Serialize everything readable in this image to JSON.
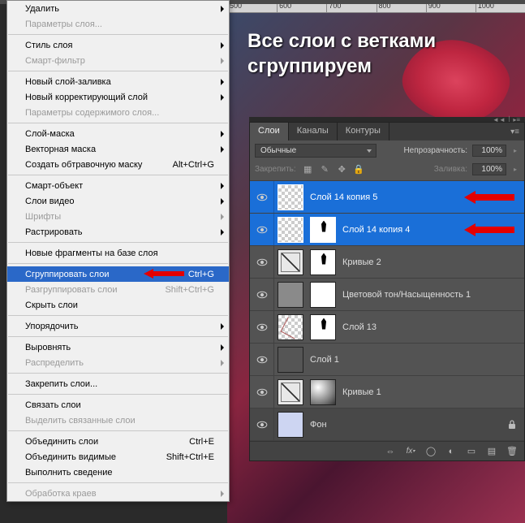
{
  "ruler": [
    "500",
    "600",
    "700",
    "800",
    "900",
    "1000"
  ],
  "canvas_title_line1": "Все слои с ветками",
  "canvas_title_line2": "сгруппируем",
  "menu": {
    "items": [
      {
        "label": "Удалить",
        "arrow": true,
        "disabled": false
      },
      {
        "label": "Параметры слоя...",
        "disabled": true
      },
      {
        "sep": true
      },
      {
        "label": "Стиль слоя",
        "arrow": true
      },
      {
        "label": "Смарт-фильтр",
        "arrow": true,
        "disabled": true
      },
      {
        "sep": true
      },
      {
        "label": "Новый слой-заливка",
        "arrow": true
      },
      {
        "label": "Новый корректирующий слой",
        "arrow": true
      },
      {
        "label": "Параметры содержимого слоя...",
        "disabled": true
      },
      {
        "sep": true
      },
      {
        "label": "Слой-маска",
        "arrow": true
      },
      {
        "label": "Векторная маска",
        "arrow": true
      },
      {
        "label": "Создать обтравочную маску",
        "shortcut": "Alt+Ctrl+G"
      },
      {
        "sep": true
      },
      {
        "label": "Смарт-объект",
        "arrow": true
      },
      {
        "label": "Слои видео",
        "arrow": true
      },
      {
        "label": "Шрифты",
        "arrow": true,
        "disabled": true
      },
      {
        "label": "Растрировать",
        "arrow": true
      },
      {
        "sep": true
      },
      {
        "label": "Новые фрагменты на базе слоя"
      },
      {
        "sep": true
      },
      {
        "label": "Сгруппировать слои",
        "shortcut": "Ctrl+G",
        "highlighted": true,
        "arrow_ind": true
      },
      {
        "label": "Разгруппировать слои",
        "shortcut": "Shift+Ctrl+G",
        "disabled": true
      },
      {
        "label": "Скрыть слои"
      },
      {
        "sep": true
      },
      {
        "label": "Упорядочить",
        "arrow": true
      },
      {
        "sep": true
      },
      {
        "label": "Выровнять",
        "arrow": true
      },
      {
        "label": "Распределить",
        "arrow": true,
        "disabled": true
      },
      {
        "sep": true
      },
      {
        "label": "Закрепить слои..."
      },
      {
        "sep": true
      },
      {
        "label": "Связать слои"
      },
      {
        "label": "Выделить связанные слои",
        "disabled": true
      },
      {
        "sep": true
      },
      {
        "label": "Объединить слои",
        "shortcut": "Ctrl+E"
      },
      {
        "label": "Объединить видимые",
        "shortcut": "Shift+Ctrl+E"
      },
      {
        "label": "Выполнить сведение"
      },
      {
        "sep": true
      },
      {
        "label": "Обработка краев",
        "arrow": true,
        "disabled": true
      }
    ]
  },
  "panel": {
    "tabs": {
      "layers": "Слои",
      "channels": "Каналы",
      "paths": "Контуры"
    },
    "blend_mode": "Обычные",
    "opacity_label": "Непрозрачность:",
    "opacity_value": "100%",
    "lock_label": "Закрепить:",
    "fill_label": "Заливка:",
    "fill_value": "100%",
    "layers": [
      {
        "name": "Слой 14 копия 5",
        "selected": true,
        "thumbs": [
          "checker"
        ],
        "arrow": true
      },
      {
        "name": "Слой 14 копия 4",
        "selected": true,
        "thumbs": [
          "checker",
          "mask-blot"
        ],
        "arrow": true
      },
      {
        "name": "Кривые 2",
        "thumbs": [
          "curves",
          "mask-blot"
        ]
      },
      {
        "name": "Цветовой тон/Насыщенность 1",
        "thumbs": [
          "gray",
          "mask"
        ]
      },
      {
        "name": "Слой 13",
        "thumbs": [
          "scribble",
          "mask-blot"
        ]
      },
      {
        "name": "Слой 1",
        "thumbs": [
          "dark"
        ]
      },
      {
        "name": "Кривые 1",
        "thumbs": [
          "curves",
          "wash"
        ]
      },
      {
        "name": "Фон",
        "thumbs": [
          "lightblue"
        ],
        "locked": true,
        "bg": true
      }
    ]
  }
}
